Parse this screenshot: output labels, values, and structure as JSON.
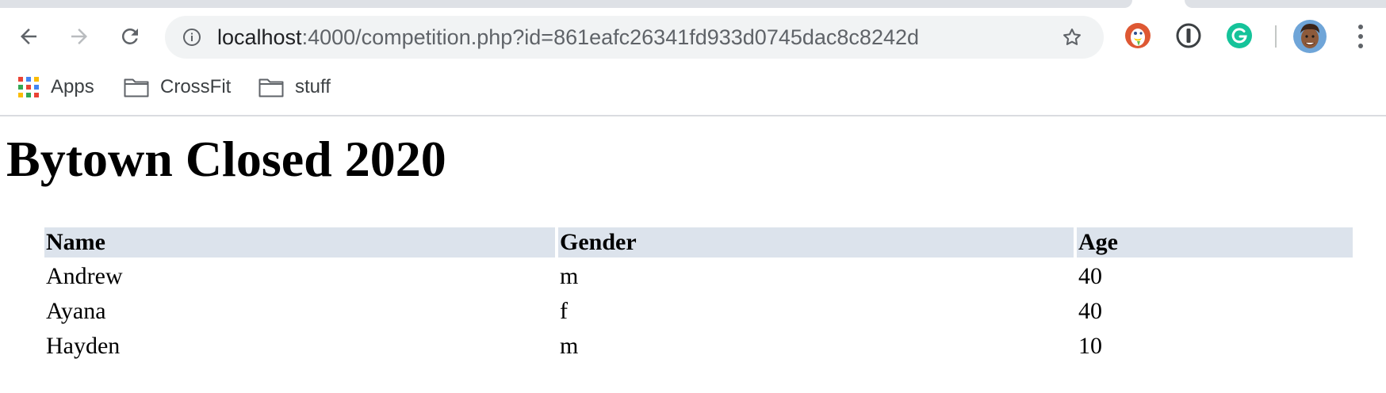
{
  "browser": {
    "url_host": "localhost",
    "url_rest": ":4000/competition.php?id=861eafc26341fd933d0745dac8c8242d",
    "bookmarks": [
      {
        "label": "Apps",
        "icon": "apps-grid-icon"
      },
      {
        "label": "CrossFit",
        "icon": "folder-icon"
      },
      {
        "label": "stuff",
        "icon": "folder-icon"
      }
    ],
    "extensions": [
      "duckduckgo-icon",
      "1password-icon",
      "grammarly-icon"
    ],
    "colors": {
      "omnibox_bg": "#f1f3f4",
      "tab_strip": "#dee1e6",
      "grammarly": "#15c39a",
      "duckduckgo": "#de5833"
    }
  },
  "page": {
    "title": "Bytown Closed 2020",
    "table": {
      "header_bg": "#dce3ec",
      "columns": [
        "Name",
        "Gender",
        "Age"
      ],
      "rows": [
        {
          "name": "Andrew",
          "gender": "m",
          "age": "40"
        },
        {
          "name": "Ayana",
          "gender": "f",
          "age": "40"
        },
        {
          "name": "Hayden",
          "gender": "m",
          "age": "10"
        }
      ]
    }
  }
}
